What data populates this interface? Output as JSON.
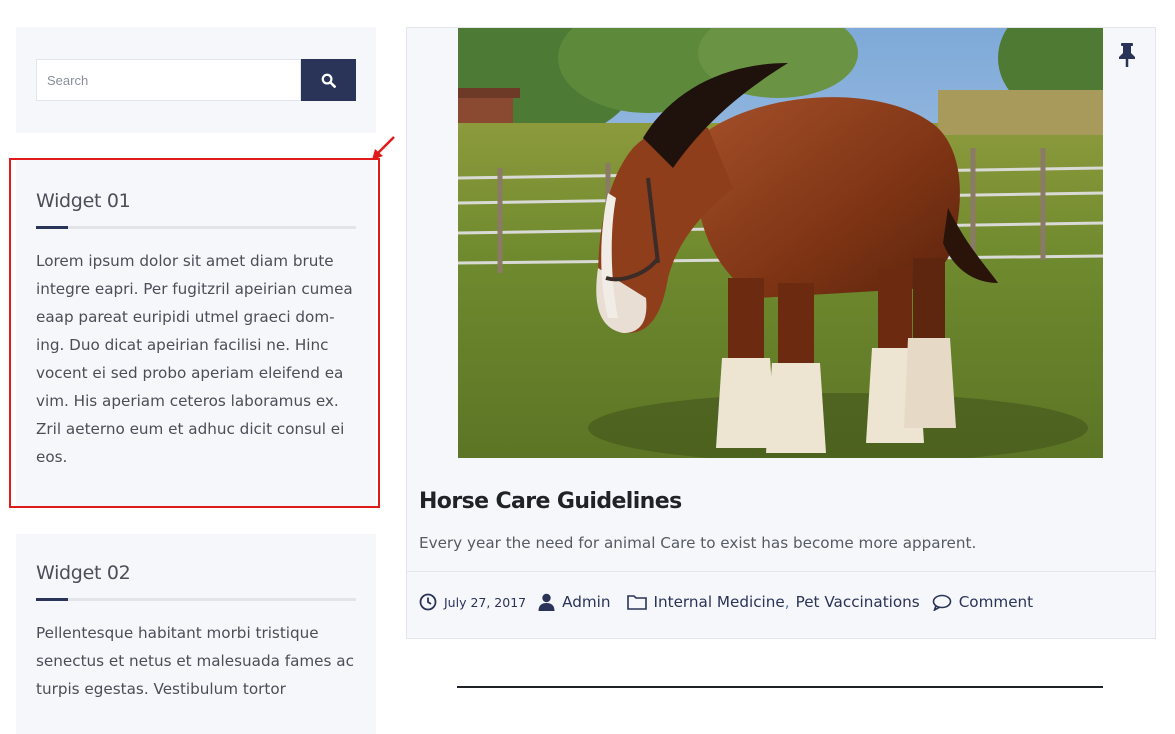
{
  "search": {
    "placeholder": "Search",
    "button_icon": "search-icon"
  },
  "widgets": [
    {
      "title": "Widget 01",
      "text": "Lorem ipsum dolor sit amet diam brute integre eapri. Per fugitzril apeirian cumea eaap pareat euripidi utmel graeci dom-ing. Duo dicat apeirian facilisi ne. Hinc vocent ei sed probo aperiam eleifend ea vim. His aperiam ceteros laboramus ex. Zril aeterno eum et adhuc dicit consul ei eos."
    },
    {
      "title": "Widget 02",
      "text": "Pellentesque habitant morbi tristique senectus et netus et malesuada fames ac turpis egestas. Vestibulum tortor"
    }
  ],
  "post": {
    "pin_icon": "pushpin-icon",
    "image_subject": "horse-photo",
    "title": "Horse Care Guidelines",
    "excerpt": "Every year the need for animal Care to exist has become more apparent.",
    "meta": {
      "date": "July 27, 2017",
      "author": "Admin",
      "categories": [
        "Internal Medicine",
        "Pet Vaccinations"
      ],
      "category_separator": ",",
      "comment_label": "Comment"
    }
  },
  "colors": {
    "accent": "#2a3358",
    "panel": "#f6f7fa",
    "highlight": "#e01b1b",
    "category_separator": "#4a7fc1"
  }
}
